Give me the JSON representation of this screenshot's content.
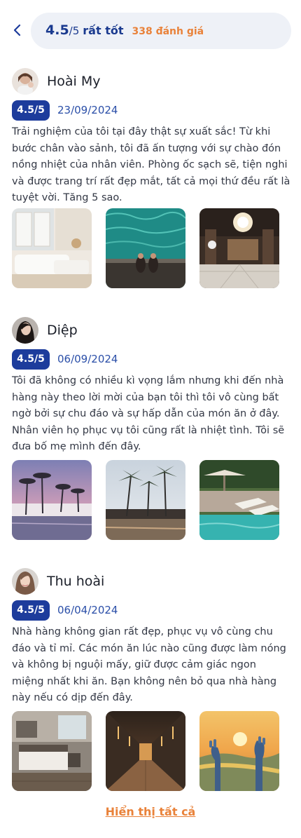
{
  "header": {
    "score": "4.5",
    "score_max": "/5",
    "rating_label": "rất tốt",
    "review_count": "338 đánh giá"
  },
  "reviews": [
    {
      "name": "Hoài My",
      "rating": "4.5/5",
      "date": "23/09/2024",
      "text": "Trải nghiệm của tôi tại đây thật sự xuất sắc! Từ khi bước chân vào sảnh, tôi đã ấn tượng với sự chào đón nồng nhiệt của nhân viên. Phòng ốc sạch sẽ, tiện nghi và được trang trí rất đẹp mắt, tất cả mọi thứ đều rất là tuyệt vời. Tăng 5 sao.",
      "photos": [
        "white-living-room-photo",
        "pool-aerial-photo",
        "chandelier-lobby-photo"
      ]
    },
    {
      "name": "Diệp",
      "rating": "4.5/5",
      "date": "06/09/2024",
      "text": "Tôi đã không có nhiều kì vọng lắm nhưng khi đến nhà hàng này theo lời mời của bạn tôi thì tôi vô cùng bất ngờ bởi sự chu đáo và sự hấp dẫn của món ăn ở đây. Nhân viên họ phục vụ tôi cũng rất là nhiệt tình. Tôi sẽ đưa bố mẹ mình đến đây.",
      "photos": [
        "palm-resort-dusk-photo",
        "palm-pool-photo",
        "sunbed-pool-photo"
      ]
    },
    {
      "name": "Thu hoài",
      "rating": "4.5/5",
      "date": "06/04/2024",
      "text": "Nhà hàng không gian rất đẹp, phục vụ vô cùng chu đáo và tỉ mỉ. Các món ăn lúc nào cũng được làm nóng và không bị nguội mấy, giữ được cảm giác ngon miệng nhất khi ăn. Bạn không nên bỏ qua nhà hàng này nếu có dịp đến đây.",
      "photos": [
        "bedroom-photo",
        "hotel-corridor-photo",
        "golden-bridge-photo"
      ]
    }
  ],
  "footer": {
    "show_all": "Hiển thị tất cả"
  },
  "colors": {
    "primary": "#1d3c9c",
    "accent": "#e9823a",
    "pill_bg": "#eef1f7"
  },
  "icons": {
    "back": "chevron-left-icon"
  }
}
